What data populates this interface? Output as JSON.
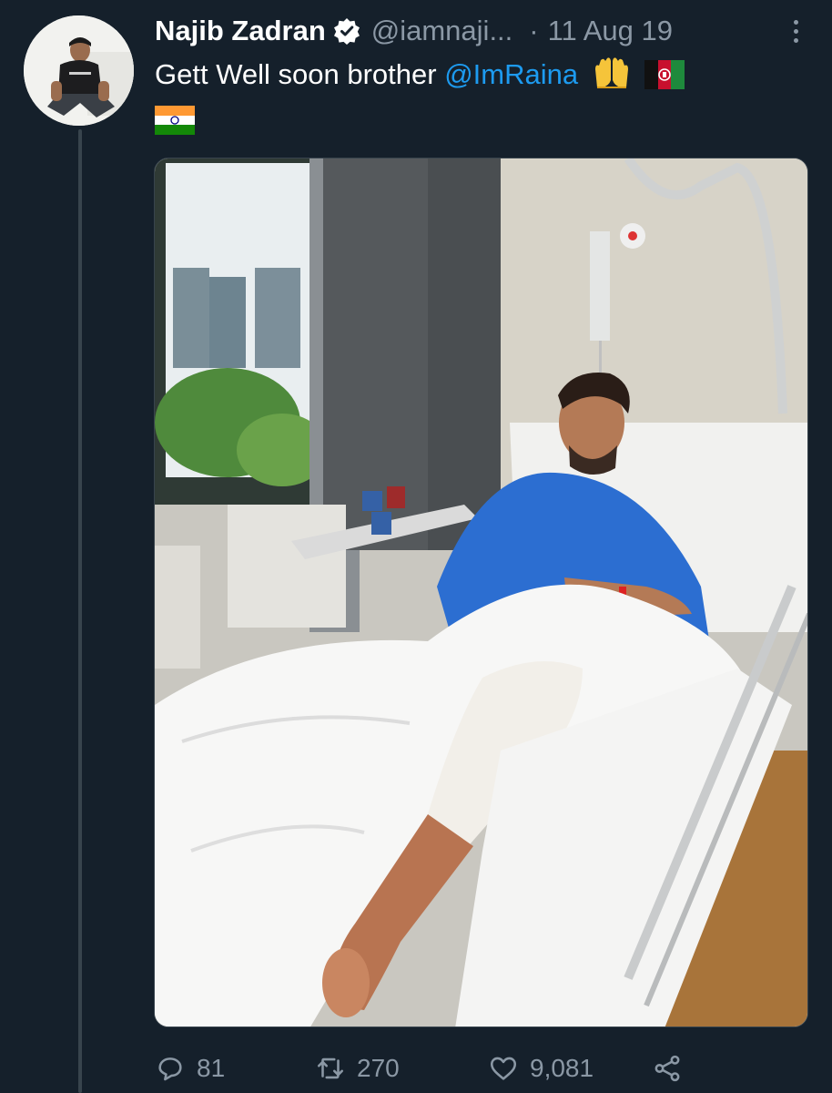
{
  "tweet": {
    "author_name": "Najib Zadran",
    "handle": "@iamnaji...",
    "separator": "·",
    "date": "11 Aug 19",
    "text_prefix": "Gett Well soon brother ",
    "mention": "@ImRaina",
    "emojis": [
      "raising-hands",
      "afghanistan-flag",
      "india-flag"
    ]
  },
  "actions": {
    "replies": "81",
    "retweets": "270",
    "likes": "9,081"
  },
  "colors": {
    "background": "#15202b",
    "text": "#ffffff",
    "muted": "#8b98a5",
    "link": "#1d9bf0",
    "thread_line": "#38444d"
  }
}
